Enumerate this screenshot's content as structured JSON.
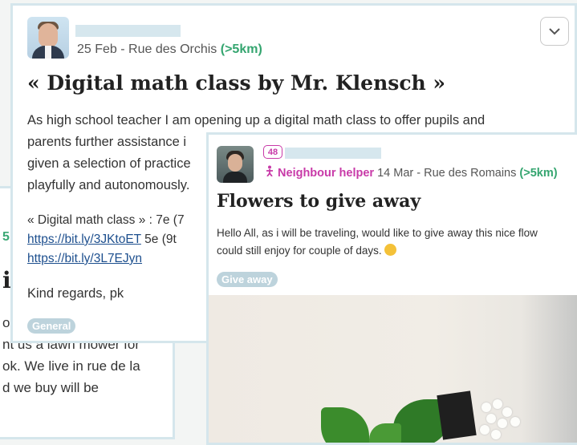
{
  "back_card": {
    "green_fragment": "5",
    "title_fragment": "i",
    "lines": [
      "on",
      "nt us a lawn mower for",
      "ok. We live in rue de la",
      "d we buy will be"
    ]
  },
  "post_a": {
    "date_location": "25 Feb - Rue des Orchis",
    "distance": "(>5km)",
    "title": "« Digital math class by Mr. Klensch »",
    "paragraph_lines": [
      "As high school teacher I am opening up a digital math class to offer pupils and",
      "parents further assistance i",
      "given a selection of practice",
      "playfully and autonomously."
    ],
    "links_line1_prefix": "« Digital math class » : 7e (7",
    "link1": "https://bit.ly/3JKtoET",
    "links_line2_suffix": " 5e (9t",
    "link2": "https://bit.ly/3L7EJyn",
    "signoff": "Kind regards, pk",
    "tag": "General",
    "menu_icon": "chevron-down-icon"
  },
  "post_b": {
    "level_badge": "48",
    "role": "Neighbour helper",
    "date_location": "14 Mar - Rue des Romains",
    "distance": "(>5km)",
    "title": "Flowers to give away",
    "body_line1": "Hello All, as i will be traveling, would like to give away this nice flow",
    "body_line2": "could still enjoy for couple of days.",
    "emoji_icon": "grinning-face-icon",
    "tag": "Give away"
  },
  "colors": {
    "accent_green": "#34a56f",
    "helper_magenta": "#c83aa8",
    "card_border": "#d5e6ec",
    "tag_bg": "#bdd3dc"
  }
}
